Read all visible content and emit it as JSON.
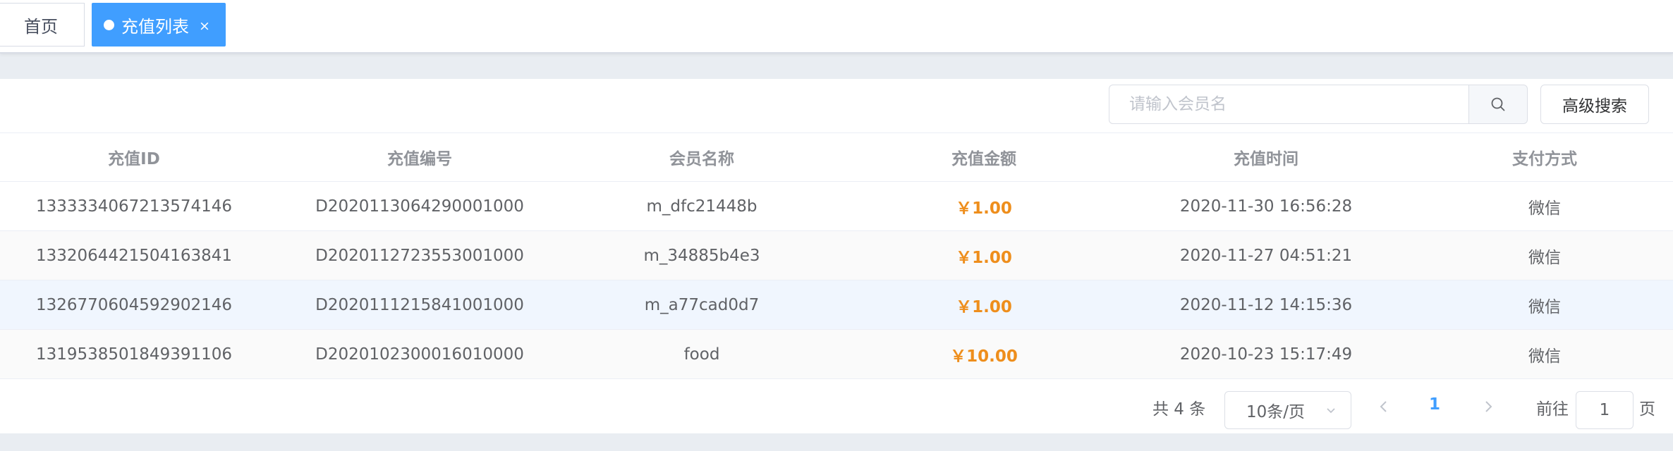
{
  "tabs": [
    {
      "label": "首页"
    },
    {
      "label": "充值列表",
      "close": "×"
    }
  ],
  "search": {
    "placeholder": "请输入会员名",
    "value": "",
    "icon": "search-icon"
  },
  "advanced_search_label": "高级搜索",
  "table": {
    "headers": [
      "充值ID",
      "充值编号",
      "会员名称",
      "充值金额",
      "充值时间",
      "支付方式"
    ],
    "rows": [
      {
        "id": "1333334067213574146",
        "no": "D2020113064290001000",
        "member": "m_dfc21448b",
        "amount": "￥1.00",
        "time": "2020-11-30 16:56:28",
        "pay": "微信"
      },
      {
        "id": "1332064421504163841",
        "no": "D2020112723553001000",
        "member": "m_34885b4e3",
        "amount": "￥1.00",
        "time": "2020-11-27 04:51:21",
        "pay": "微信"
      },
      {
        "id": "1326770604592902146",
        "no": "D2020111215841001000",
        "member": "m_a77cad0d7",
        "amount": "￥1.00",
        "time": "2020-11-12 14:15:36",
        "pay": "微信"
      },
      {
        "id": "1319538501849391106",
        "no": "D2020102300016010000",
        "member": "food",
        "amount": "￥10.00",
        "time": "2020-10-23 15:17:49",
        "pay": "微信"
      }
    ]
  },
  "pagination": {
    "total": "共 4 条",
    "page_size": "10条/页",
    "current": "1",
    "goto_label": "前往",
    "goto_value": "1",
    "page_unit": "页"
  },
  "colors": {
    "primary": "#409eff",
    "amount": "#ee8e1c"
  }
}
